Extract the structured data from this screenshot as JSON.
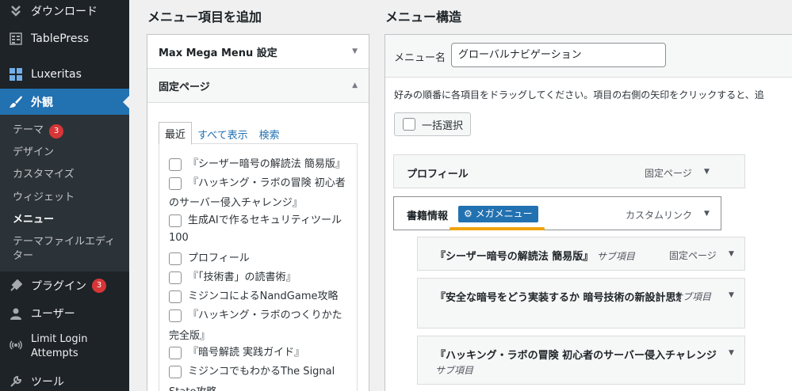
{
  "sidebar": {
    "download": "ダウンロード",
    "tablepress": "TablePress",
    "luxeritas": "Luxeritas",
    "appearance": "外観",
    "sub": {
      "themes": "テーマ",
      "themes_badge": "3",
      "design": "デザイン",
      "customize": "カスタマイズ",
      "widgets": "ウィジェット",
      "menus": "メニュー",
      "theme_editor": "テーマファイルエディター"
    },
    "plugins": "プラグイン",
    "plugins_badge": "3",
    "users": "ユーザー",
    "limit_login_1": "Limit Login",
    "limit_login_2": "Attempts",
    "tools": "ツール"
  },
  "add_items": {
    "heading": "メニュー項目を追加",
    "mega_menu_settings": "Max Mega Menu 設定",
    "pages_heading": "固定ページ",
    "tabs": [
      "最近",
      "すべて表示",
      "検索"
    ],
    "pages": [
      [
        "『シーザー暗号の解読法 簡易版』"
      ],
      [
        "『ハッキング・ラボの冒険 初心者",
        "のサーバー侵入チャレンジ』"
      ],
      [
        "生成AIで作るセキュリティツール",
        "100"
      ],
      [
        "プロフィール"
      ],
      [
        "『「技術書」の読書術』"
      ],
      [
        "ミジンコによるNandGame攻略"
      ],
      [
        "『ハッキング・ラボのつくりかた",
        "完全版』"
      ],
      [
        "『暗号解読 実践ガイド』"
      ],
      [
        "ミジンコでもわかるThe Signal",
        "State攻略"
      ]
    ]
  },
  "structure": {
    "heading": "メニュー構造",
    "name_label": "メニュー名",
    "name_value": "グローバルナビゲーション",
    "instructions": "好みの順番に各項目をドラッグしてください。項目の右側の矢印をクリックすると、追",
    "bulk_select": "一括選択",
    "mega_menu_button": "メガメニュー",
    "sub_item_label": "サブ項目",
    "items": [
      {
        "title": "プロフィール",
        "type": "固定ページ"
      },
      {
        "title": "書籍情報",
        "type": "カスタムリンク"
      },
      {
        "title": "『シーザー暗号の解読法 簡易版』",
        "type": "固定ページ"
      },
      {
        "title": "『安全な暗号をどう実装するか 暗号技術の新設計思想』",
        "type": "サブ項目"
      },
      {
        "title": "『ハッキング・ラボの冒険 初心者のサーバー侵入チャレンジ』",
        "type": "サブ項目"
      }
    ]
  },
  "colors": {
    "sidebar_bg": "#1d2327",
    "active": "#2271b1",
    "badge": "#d63638",
    "highlight": "#f0a30a"
  }
}
